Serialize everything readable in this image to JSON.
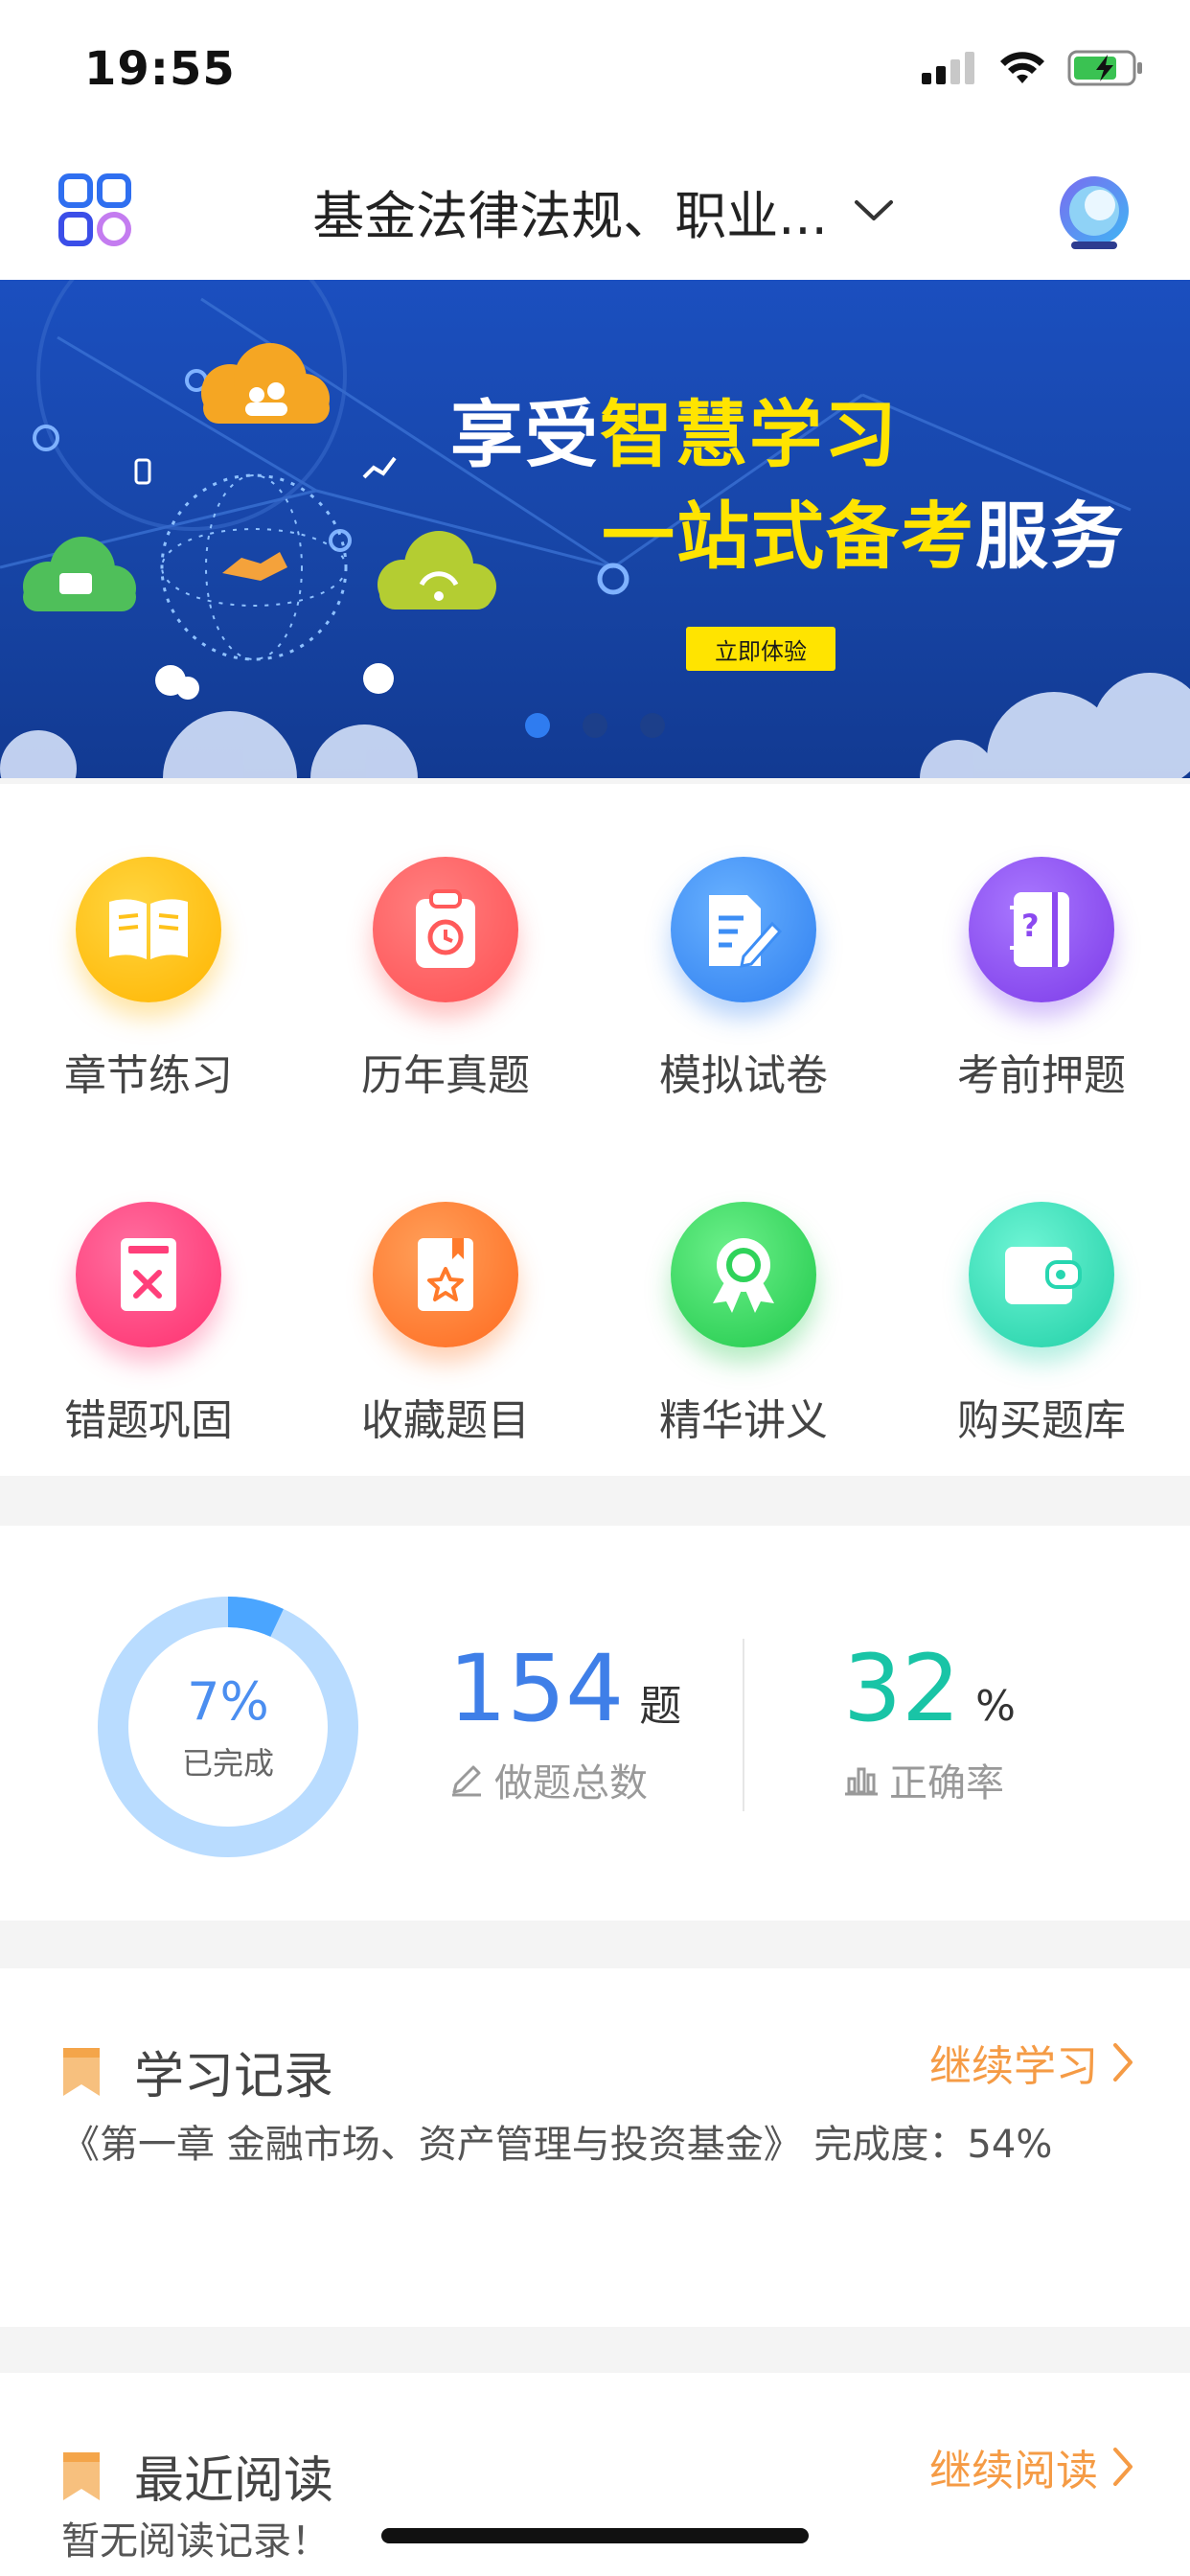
{
  "status_bar": {
    "time": "19:55"
  },
  "header": {
    "title": "基金法律法规、职业..."
  },
  "banner": {
    "line1_a": "享受",
    "line1_b": "智慧学习",
    "line2_a": "一站式备考",
    "line2_b": "服务",
    "button": "立即体验"
  },
  "features": [
    {
      "label": "章节练习",
      "icon": "book-icon",
      "color": "#ffb400"
    },
    {
      "label": "历年真题",
      "icon": "clipboard-clock-icon",
      "color": "#ff5a5a"
    },
    {
      "label": "模拟试卷",
      "icon": "document-pencil-icon",
      "color": "#3d8ef5"
    },
    {
      "label": "考前押题",
      "icon": "notebook-question-icon",
      "color": "#8b49f0"
    },
    {
      "label": "错题巩固",
      "icon": "wrong-book-icon",
      "color": "#ff3f7a"
    },
    {
      "label": "收藏题目",
      "icon": "star-bookmark-icon",
      "color": "#ff7a2a"
    },
    {
      "label": "精华讲义",
      "icon": "medal-icon",
      "color": "#2fd35a"
    },
    {
      "label": "购买题库",
      "icon": "wallet-icon",
      "color": "#27d6b0"
    }
  ],
  "stats": {
    "progress_percent": 7,
    "progress_label": "7%",
    "progress_caption": "已完成",
    "total_count": "154",
    "total_unit": "题",
    "total_label": "做题总数",
    "accuracy": "32",
    "accuracy_unit": "%",
    "accuracy_label": "正确率"
  },
  "study_record": {
    "title": "学习记录",
    "link": "继续学习",
    "detail": "《第一章 金融市场、资产管理与投资基金》 完成度：54%"
  },
  "recent_reading": {
    "title": "最近阅读",
    "link": "继续阅读",
    "detail": "暂无阅读记录！"
  },
  "colors": {
    "accent_orange": "#f59b45",
    "blue": "#3f7fe8",
    "teal": "#19c4a6"
  }
}
